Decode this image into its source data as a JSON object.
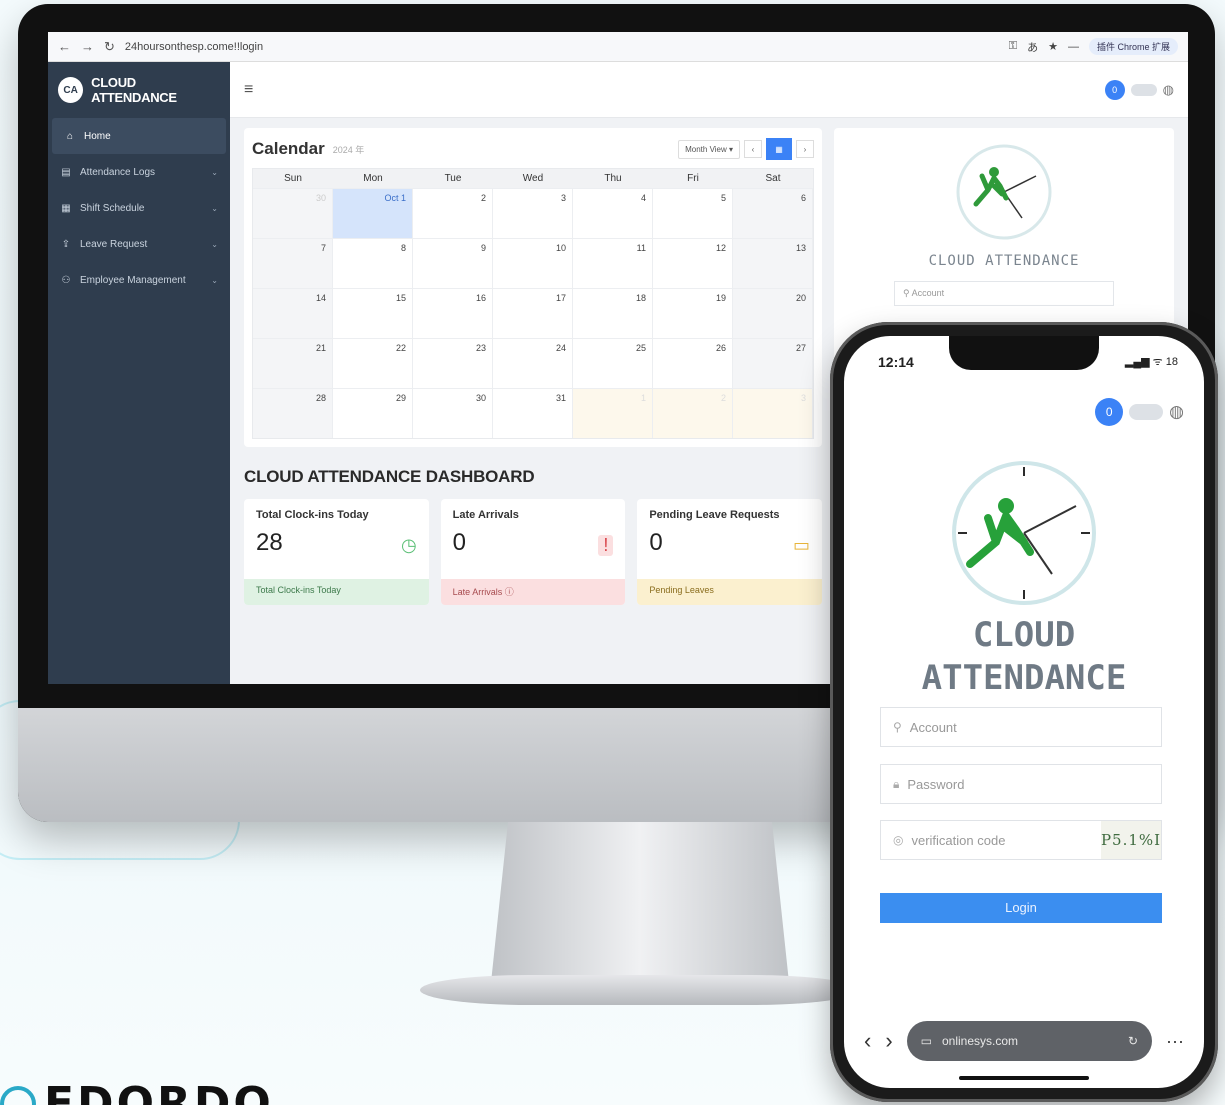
{
  "browser": {
    "url": "24hoursonthesp.come!!login",
    "extension_label": "插件 Chrome 扩展"
  },
  "app": {
    "brand_initials": "CA",
    "brand_name": "CLOUD ATTENDANCE",
    "sidebar": [
      {
        "label": "Home",
        "icon": "home-icon",
        "active": true
      },
      {
        "label": "Attendance Logs",
        "icon": "clipboard-icon"
      },
      {
        "label": "Shift Schedule",
        "icon": "calendar-icon"
      },
      {
        "label": "Leave Request",
        "icon": "upload-icon"
      },
      {
        "label": "Employee Management",
        "icon": "users-icon"
      }
    ],
    "avatar_initial": "0"
  },
  "calendar": {
    "title": "Calendar",
    "subtitle": "2024 年",
    "view_select": "Month View ▾",
    "days_of_week": [
      "Sun",
      "Mon",
      "Tue",
      "Wed",
      "Thu",
      "Fri",
      "Sat"
    ],
    "weeks": [
      [
        "30",
        "Oct 1",
        "2",
        "3",
        "4",
        "5",
        "6"
      ],
      [
        "7",
        "8",
        "9",
        "10",
        "11",
        "12",
        "13"
      ],
      [
        "14",
        "15",
        "16",
        "17",
        "18",
        "19",
        "20"
      ],
      [
        "21",
        "22",
        "23",
        "24",
        "25",
        "26",
        "27"
      ],
      [
        "28",
        "29",
        "30",
        "31",
        "1",
        "2",
        "3"
      ]
    ]
  },
  "dashboard": {
    "title": "CLOUD ATTENDANCE DASHBOARD",
    "stats": [
      {
        "label": "Total Clock-ins Today",
        "value": "28",
        "footer": "Total Clock-ins Today",
        "icon": "clock-icon",
        "icon_glyph": "◷",
        "color": "green"
      },
      {
        "label": "Late Arrivals",
        "value": "0",
        "footer": "Late Arrivals ⓘ",
        "icon": "alert-icon",
        "icon_glyph": "!",
        "color": "red"
      },
      {
        "label": "Pending Leave Requests",
        "value": "0",
        "footer": "Pending Leaves",
        "icon": "folder-icon",
        "icon_glyph": "▭",
        "color": "yellow"
      }
    ]
  },
  "login_panel": {
    "title": "CLOUD ATTENDANCE",
    "account_placeholder": "Account"
  },
  "phone": {
    "time": "12:14",
    "status": "▂▄▆ ᯤ 18",
    "avatar_initial": "0",
    "title_line1": "CLOUD",
    "title_line2": "ATTENDANCE",
    "account_placeholder": "Account",
    "password_placeholder": "Password",
    "verification_placeholder": "verification code",
    "captcha": "P5.1%I",
    "login_label": "Login",
    "url": "onlinesys.com"
  },
  "corner_brand": "EDORDO"
}
